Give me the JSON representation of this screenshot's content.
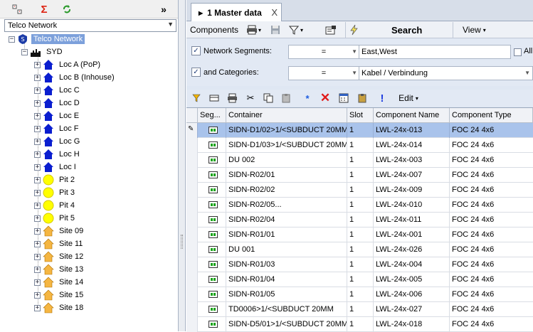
{
  "left": {
    "network_select": "Telco Network",
    "tree": {
      "root": "Telco Network",
      "site": "SYD",
      "locations": [
        "Loc A (PoP)",
        "Loc B (Inhouse)",
        "Loc C",
        "Loc D",
        "Loc E",
        "Loc F",
        "Loc G",
        "Loc H",
        "Loc I"
      ],
      "pits": [
        "Pit 2",
        "Pit 3",
        "Pit 4",
        "Pit 5"
      ],
      "sites": [
        "Site 09",
        "Site 11",
        "Site 12",
        "Site 13",
        "Site 14",
        "Site 15",
        "Site 18"
      ]
    },
    "collapse_label": "»"
  },
  "tab": {
    "label": "1 Master data",
    "close": "X"
  },
  "toolbar": {
    "components": "Components",
    "search": "Search",
    "view": "View"
  },
  "filters": [
    {
      "checked": true,
      "label": "Network Segments:",
      "operator": "=",
      "value": "East,West",
      "all_label": "All"
    },
    {
      "checked": true,
      "label": "and Categories:",
      "operator": "=",
      "value": "Kabel / Verbindung"
    }
  ],
  "toolbar2": {
    "edit": "Edit"
  },
  "grid": {
    "columns": [
      "Seg...",
      "Container",
      "Slot",
      "Component Name",
      "Component Type"
    ],
    "rows": [
      {
        "container": "SIDN-D1/02>1/<SUBDUCT 20MM",
        "slot": "1",
        "name": "LWL-24x-013",
        "type": "FOC 24 4x6"
      },
      {
        "container": "SIDN-D1/03>1/<SUBDUCT 20MM",
        "slot": "1",
        "name": "LWL-24x-014",
        "type": "FOC 24 4x6"
      },
      {
        "container": "DU 002",
        "slot": "1",
        "name": "LWL-24x-003",
        "type": "FOC 24 4x6"
      },
      {
        "container": "SIDN-R02/01",
        "slot": "1",
        "name": "LWL-24x-007",
        "type": "FOC 24 4x6"
      },
      {
        "container": "SIDN-R02/02",
        "slot": "1",
        "name": "LWL-24x-009",
        "type": "FOC 24 4x6"
      },
      {
        "container": "SIDN-R02/05...",
        "slot": "1",
        "name": "LWL-24x-010",
        "type": "FOC 24 4x6"
      },
      {
        "container": "SIDN-R02/04",
        "slot": "1",
        "name": "LWL-24x-011",
        "type": "FOC 24 4x6"
      },
      {
        "container": "SIDN-R01/01",
        "slot": "1",
        "name": "LWL-24x-001",
        "type": "FOC 24 4x6"
      },
      {
        "container": "DU 001",
        "slot": "1",
        "name": "LWL-24x-026",
        "type": "FOC 24 4x6"
      },
      {
        "container": "SIDN-R01/03",
        "slot": "1",
        "name": "LWL-24x-004",
        "type": "FOC 24 4x6"
      },
      {
        "container": "SIDN-R01/04",
        "slot": "1",
        "name": "LWL-24x-005",
        "type": "FOC 24 4x6"
      },
      {
        "container": "SIDN-R01/05",
        "slot": "1",
        "name": "LWL-24x-006",
        "type": "FOC 24 4x6"
      },
      {
        "container": "TD0006>1/<SUBDUCT 20MM",
        "slot": "1",
        "name": "LWL-24x-027",
        "type": "FOC 24 4x6"
      },
      {
        "container": "SIDN-D5/01>1/<SUBDUCT 20MM",
        "slot": "1",
        "name": "LWL-24x-018",
        "type": "FOC 24 4x6"
      }
    ]
  },
  "colors": {
    "selection": "#a9c3eb",
    "tree_selection": "#7ca0db",
    "location_icon": "#0a1ecf",
    "pit_icon": "#ffff00",
    "site_icon": "#f5b642"
  }
}
